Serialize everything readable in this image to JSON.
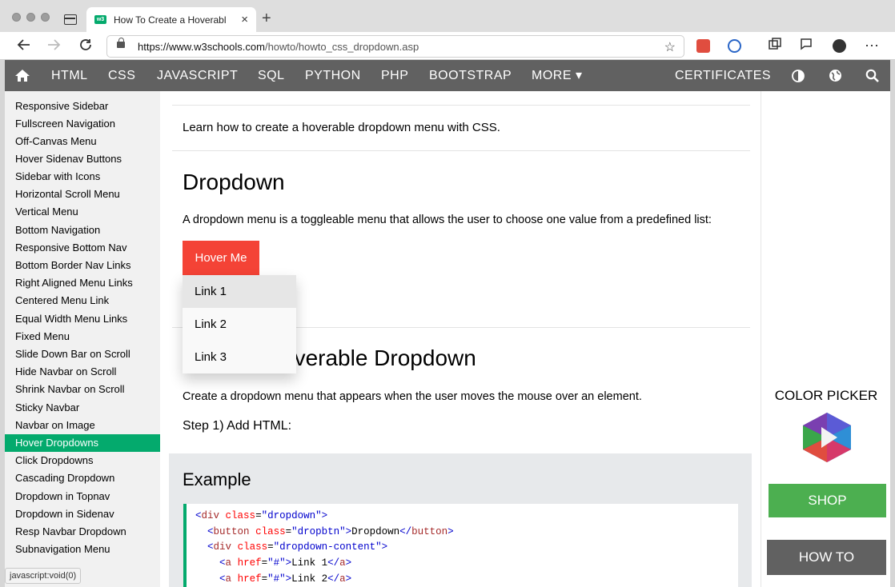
{
  "browser": {
    "tab_title": "How To Create a Hoverable Dr",
    "tab_close": "×",
    "new_tab": "+",
    "url_host": "https://www.w3schools.com",
    "url_path": "/howto/howto_css_dropdown.asp",
    "favicon_text": "w3",
    "status_text": "javascript:void(0)"
  },
  "topnav": {
    "items": [
      "HTML",
      "CSS",
      "JAVASCRIPT",
      "SQL",
      "PYTHON",
      "PHP",
      "BOOTSTRAP",
      "MORE ▾"
    ],
    "certificates": "CERTIFICATES",
    "icons": [
      "home-icon",
      "contrast-icon",
      "globe-icon",
      "search-icon"
    ]
  },
  "sidebar": {
    "items": [
      "Responsive Sidebar",
      "Fullscreen Navigation",
      "Off-Canvas Menu",
      "Hover Sidenav Buttons",
      "Sidebar with Icons",
      "Horizontal Scroll Menu",
      "Vertical Menu",
      "Bottom Navigation",
      "Responsive Bottom Nav",
      "Bottom Border Nav Links",
      "Right Aligned Menu Links",
      "Centered Menu Link",
      "Equal Width Menu Links",
      "Fixed Menu",
      "Slide Down Bar on Scroll",
      "Hide Navbar on Scroll",
      "Shrink Navbar on Scroll",
      "Sticky Navbar",
      "Navbar on Image",
      "Hover Dropdowns",
      "Click Dropdowns",
      "Cascading Dropdown",
      "Dropdown in Topnav",
      "Dropdown in Sidenav",
      "Resp Navbar Dropdown",
      "Subnavigation Menu"
    ],
    "active_item": "Hover Dropdowns",
    "active_color": "#04aa6d"
  },
  "main": {
    "intro": "Learn how to create a hoverable dropdown menu with CSS.",
    "heading": "Dropdown",
    "description": "A dropdown menu is a toggleable menu that allows the user to choose one value from a predefined list:",
    "demo_button": "Hover Me",
    "demo_button_color": "#f44336",
    "dropdown_links": [
      "Link 1",
      "Link 2",
      "Link 3"
    ],
    "heading2": "Create A Hoverable Dropdown",
    "heading2_visible": "overable Dropdown",
    "desc2": "Create a dropdown menu that appears when the user moves the mouse over an element.",
    "step1": "Step 1) Add HTML:",
    "example_title": "Example"
  },
  "right": {
    "color_picker_title": "COLOR PICKER",
    "shop_label": "SHOP",
    "howto_label": "HOW TO",
    "shop_color": "#4caf50"
  }
}
